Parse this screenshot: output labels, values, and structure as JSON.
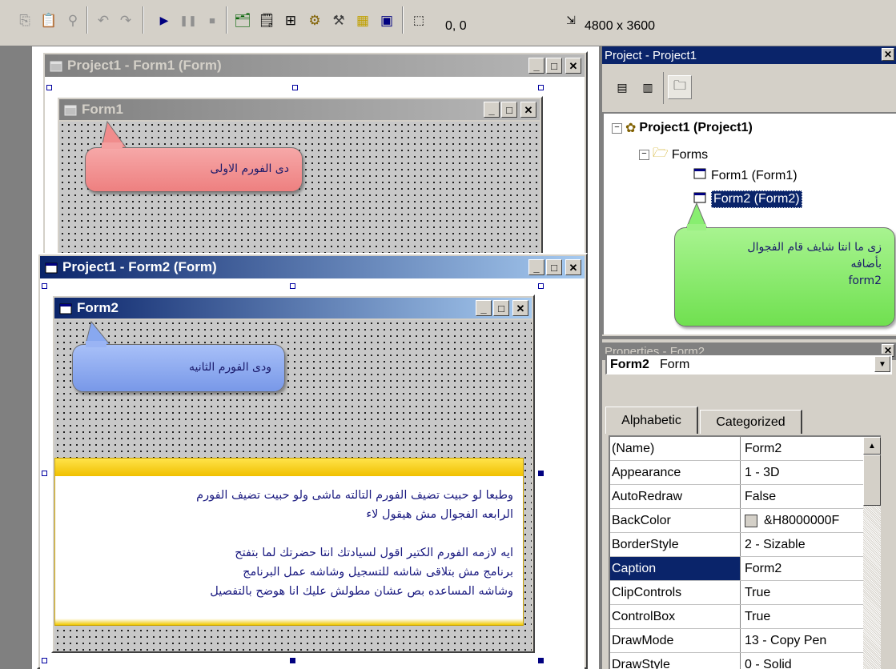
{
  "toolbar": {
    "buttons": [
      "copy-icon",
      "paste-icon",
      "find-icon",
      "undo-icon",
      "redo-icon",
      "start-icon",
      "break-icon",
      "end-icon",
      "project-explorer-icon",
      "properties-window-icon",
      "form-layout-icon",
      "object-browser-icon",
      "toolbox-icon",
      "data-view-icon",
      "component-manager-icon"
    ],
    "position_readout": "0, 0",
    "size_readout": "4800 x 3600"
  },
  "designer": {
    "form1_window_title": "Project1 - Form1 (Form)",
    "form1_caption": "Form1",
    "form2_window_title": "Project1 - Form2 (Form)",
    "form2_caption": "Form2",
    "callout_form1": "دى الفورم الاولى",
    "callout_form2": "ودى الفورم الثانيه",
    "note_lines": [
      "وطبعا لو حبيت تضيف الفورم التالته ماشى ولو حبيت تضيف الفورم",
      "الرابعه الفجوال مش هيقول لاء",
      "",
      "ايه لازمه الفورم الكتير اقول لسيادتك انتا حضرتك لما بتفتح",
      "برنامج مش بتلاقى شاشه للتسجيل وشاشه عمل البرنامج",
      "وشاشه المساعده بص عشان مطولش عليك انا هوضح بالتفصيل"
    ]
  },
  "project_panel": {
    "title": "Project - Project1",
    "close": "✕",
    "root": "Project1 (Project1)",
    "folder": "Forms",
    "items": [
      "Form1 (Form1)",
      "Form2 (Form2)"
    ],
    "callout_lines": [
      "زى ما انتا شايف قام الفجوال",
      "بأضافه",
      "form2"
    ]
  },
  "properties_panel": {
    "title": "Properties - Form2",
    "close": "✕",
    "object_name": "Form2",
    "object_type": "Form",
    "tabs": [
      "Alphabetic",
      "Categorized"
    ],
    "rows": [
      {
        "name": "(Name)",
        "value": "Form2"
      },
      {
        "name": "Appearance",
        "value": "1 - 3D"
      },
      {
        "name": "AutoRedraw",
        "value": "False"
      },
      {
        "name": "BackColor",
        "value": "&H8000000F"
      },
      {
        "name": "BorderStyle",
        "value": "2 - Sizable"
      },
      {
        "name": "Caption",
        "value": "Form2"
      },
      {
        "name": "ClipControls",
        "value": "True"
      },
      {
        "name": "ControlBox",
        "value": "True"
      },
      {
        "name": "DrawMode",
        "value": "13 - Copy Pen"
      },
      {
        "name": "DrawStyle",
        "value": "0 - Solid"
      }
    ],
    "selected_row": "Caption"
  },
  "colors": {
    "active_title": "#0a246a",
    "selection": "#0a246a",
    "callout_red": "#f08c8c",
    "callout_blue": "#88a8f0",
    "callout_green": "#88ee70"
  }
}
